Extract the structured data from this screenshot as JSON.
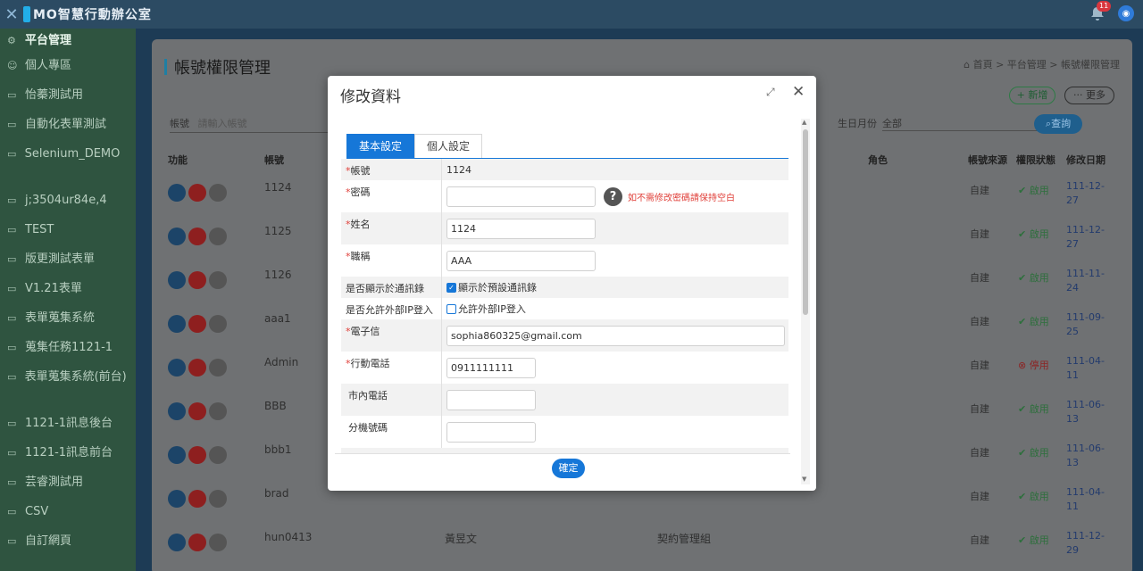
{
  "app": {
    "title": "MO智慧行動辦公室",
    "notification_count": "11"
  },
  "sidebar": {
    "items": [
      {
        "label": "平台管理",
        "icon": "gear-icon",
        "active": true
      },
      {
        "label": "個人專區",
        "icon": "user-icon"
      },
      {
        "label": "怡蓁測試用",
        "icon": "folder-icon"
      },
      {
        "label": "自動化表單測試",
        "icon": "folder-icon"
      },
      {
        "label": "Selenium_DEMO",
        "icon": "folder-icon"
      },
      {
        "label": "j;3504ur84e,4",
        "icon": "folder-icon"
      },
      {
        "label": "TEST",
        "icon": "folder-icon"
      },
      {
        "label": "版更測試表單",
        "icon": "folder-icon"
      },
      {
        "label": "V1.21表單",
        "icon": "folder-icon"
      },
      {
        "label": "表單蒐集系統",
        "icon": "folder-icon"
      },
      {
        "label": "蒐集任務1121-1",
        "icon": "folder-icon"
      },
      {
        "label": "表單蒐集系統(前台)",
        "icon": "folder-icon"
      },
      {
        "label": "1121-1訊息後台",
        "icon": "folder-icon"
      },
      {
        "label": "1121-1訊息前台",
        "icon": "folder-icon"
      },
      {
        "label": "芸睿測試用",
        "icon": "folder-icon"
      },
      {
        "label": "CSV",
        "icon": "folder-icon"
      },
      {
        "label": "自訂網頁",
        "icon": "folder-icon"
      }
    ]
  },
  "page": {
    "title": "帳號權限管理",
    "breadcrumb": "首頁 > 平台管理 > 帳號權限管理",
    "add_label": "+ 新增",
    "more_label": "··· 更多",
    "filter_account_label": "帳號",
    "filter_account_placeholder": "請輸入帳號",
    "filter_birth_label": "生日月份",
    "filter_birth_value": "全部",
    "query_label": "查詢"
  },
  "table": {
    "headers": {
      "ops": "功能",
      "account": "帳號",
      "role": "角色",
      "source": "帳號來源",
      "status": "權限狀態",
      "date": "修改日期"
    },
    "rows": [
      {
        "account": "1124",
        "name": "",
        "group": "",
        "source": "自建",
        "status": "啟用",
        "date": "111-12-27"
      },
      {
        "account": "1125",
        "name": "",
        "group": "",
        "source": "自建",
        "status": "啟用",
        "date": "111-12-27"
      },
      {
        "account": "1126",
        "name": "",
        "group": "",
        "source": "自建",
        "status": "啟用",
        "date": "111-11-24"
      },
      {
        "account": "aaa1",
        "name": "",
        "group": "",
        "source": "自建",
        "status": "啟用",
        "date": "111-09-25"
      },
      {
        "account": "Admin",
        "name": "",
        "group": "",
        "source": "自建",
        "status": "停用",
        "date": "111-04-11"
      },
      {
        "account": "BBB",
        "name": "",
        "group": "",
        "source": "自建",
        "status": "啟用",
        "date": "111-06-13"
      },
      {
        "account": "bbb1",
        "name": "",
        "group": "",
        "source": "自建",
        "status": "啟用",
        "date": "111-06-13"
      },
      {
        "account": "brad",
        "name": "",
        "group": "",
        "source": "自建",
        "status": "啟用",
        "date": "111-04-11"
      },
      {
        "account": "hun0413",
        "name": "黃昱文",
        "group": "契約管理組",
        "source": "自建",
        "status": "啟用",
        "date": "111-12-29"
      }
    ]
  },
  "modal": {
    "title": "修改資料",
    "tabs": [
      "基本設定",
      "個人設定"
    ],
    "fields": {
      "account_label": "帳號",
      "account_value": "1124",
      "password_label": "密碼",
      "password_hint": "如不需修改密碼請保持空白",
      "name_label": "姓名",
      "name_value": "1124",
      "title_label": "職稱",
      "title_value": "AAA",
      "show_contacts_label": "是否顯示於通訊錄",
      "show_contacts_option": "顯示於預設通訊錄",
      "allow_ip_label": "是否允許外部IP登入",
      "allow_ip_option": "允許外部IP登入",
      "email_label": "電子信",
      "email_value": "sophia860325@gmail.com",
      "mobile_label": "行動電話",
      "mobile_value": "0911111111",
      "phone_label": "市內電話",
      "ext_label": "分機號碼"
    },
    "confirm_label": "確定"
  }
}
